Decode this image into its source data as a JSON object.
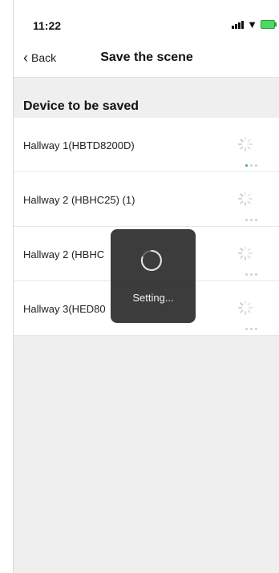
{
  "status_bar": {
    "time": "11:22"
  },
  "nav": {
    "back_label": "Back",
    "title": "Save the scene"
  },
  "section": {
    "title": "Device to be saved"
  },
  "devices": [
    {
      "name": "Hallway 1(HBTD8200D)",
      "page_dots": [
        "active",
        "inactive",
        "inactive"
      ]
    },
    {
      "name": "Hallway 2 (HBHC25) (1)",
      "page_dots": [
        "inactive",
        "inactive",
        "inactive"
      ]
    },
    {
      "name": "Hallway 2 (HBHC",
      "page_dots": [
        "inactive",
        "inactive",
        "inactive"
      ]
    },
    {
      "name": "Hallway 3(HED80",
      "page_dots": [
        "inactive",
        "inactive",
        "inactive"
      ]
    }
  ],
  "toast": {
    "label": "Setting..."
  },
  "colors": {
    "accent_green": "#43b36a",
    "toast_bg": "#303030",
    "battery_green": "#4cd964"
  },
  "icons": {
    "back": "chevron-left-icon",
    "signal": "signal-bars-icon",
    "wifi": "wifi-icon",
    "battery": "battery-charging-icon",
    "row_status": "spinner-icon",
    "loading": "loading-spinner-icon"
  }
}
